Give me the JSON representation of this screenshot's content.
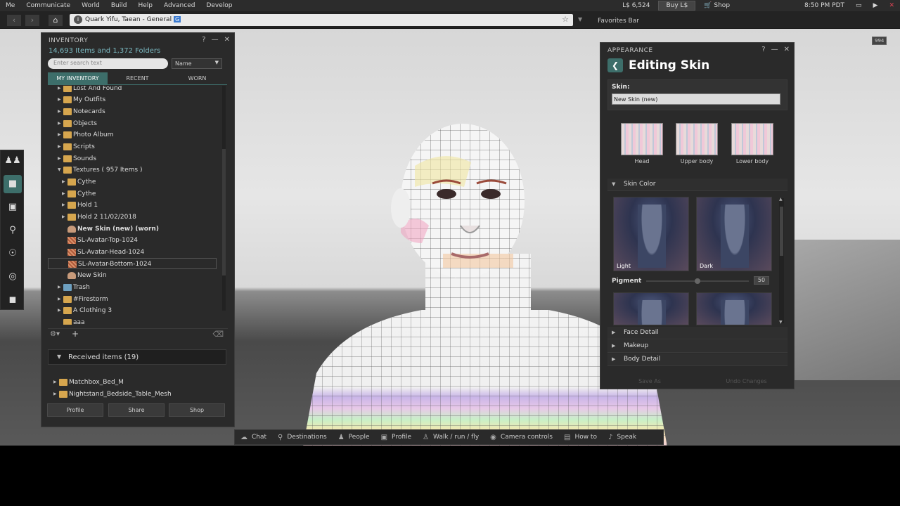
{
  "menu": {
    "items": [
      "Me",
      "Communicate",
      "World",
      "Build",
      "Help",
      "Advanced",
      "Develop"
    ],
    "balance": "L$ 6,524",
    "buy_label": "Buy L$",
    "shop_label": "Shop",
    "time": "8:50 PM PDT"
  },
  "nav": {
    "location": "Quark Yifu, Taean - General",
    "rating_badge": "G",
    "favorites_label": "Favorites Bar",
    "indicator": "994"
  },
  "inventory": {
    "title": "INVENTORY",
    "count": "14,693 Items and 1,372 Folders",
    "search_placeholder": "Enter search text",
    "sort_value": "Name",
    "tabs": [
      "MY INVENTORY",
      "RECENT",
      "WORN"
    ],
    "tree": [
      {
        "label": "Lost And Found"
      },
      {
        "label": "My Outfits"
      },
      {
        "label": "Notecards"
      },
      {
        "label": "Objects"
      },
      {
        "label": "Photo Album"
      },
      {
        "label": "Scripts"
      },
      {
        "label": "Sounds"
      },
      {
        "label": "Textures ( 957 Items )"
      },
      {
        "label": "Cythe"
      },
      {
        "label": "Cythe"
      },
      {
        "label": "Hold 1"
      },
      {
        "label": "Hold 2 11/02/2018"
      },
      {
        "label": "New Skin (new) (worn)"
      },
      {
        "label": "SL-Avatar-Top-1024"
      },
      {
        "label": "SL-Avatar-Head-1024"
      },
      {
        "label": "SL-Avatar-Bottom-1024"
      },
      {
        "label": "New Skin"
      },
      {
        "label": "Trash"
      },
      {
        "label": "#Firestorm"
      },
      {
        "label": "A Clothing 3"
      },
      {
        "label": "aaa"
      }
    ],
    "received_label": "Received items (19)",
    "received": [
      {
        "label": "Matchbox_Bed_M"
      },
      {
        "label": "Nightstand_Bedside_Table_Mesh"
      }
    ],
    "buttons": [
      "Profile",
      "Share",
      "Shop"
    ]
  },
  "appearance": {
    "title": "APPEARANCE",
    "heading": "Editing Skin",
    "skin_label": "Skin:",
    "skin_name": "New Skin (new)",
    "regions": [
      "Head",
      "Upper body",
      "Lower body"
    ],
    "sections": [
      "Skin Color",
      "Face Detail",
      "Makeup",
      "Body Detail"
    ],
    "swatches": [
      "Light",
      "Dark"
    ],
    "pigment_label": "Pigment",
    "pigment_value": "50",
    "pigment_level": 0.5,
    "save_as": "Save As",
    "undo": "Undo Changes"
  },
  "bottombar": {
    "buttons": [
      "Chat",
      "Destinations",
      "People",
      "Profile",
      "Walk / run / fly",
      "Camera controls",
      "How to",
      "Speak"
    ]
  }
}
